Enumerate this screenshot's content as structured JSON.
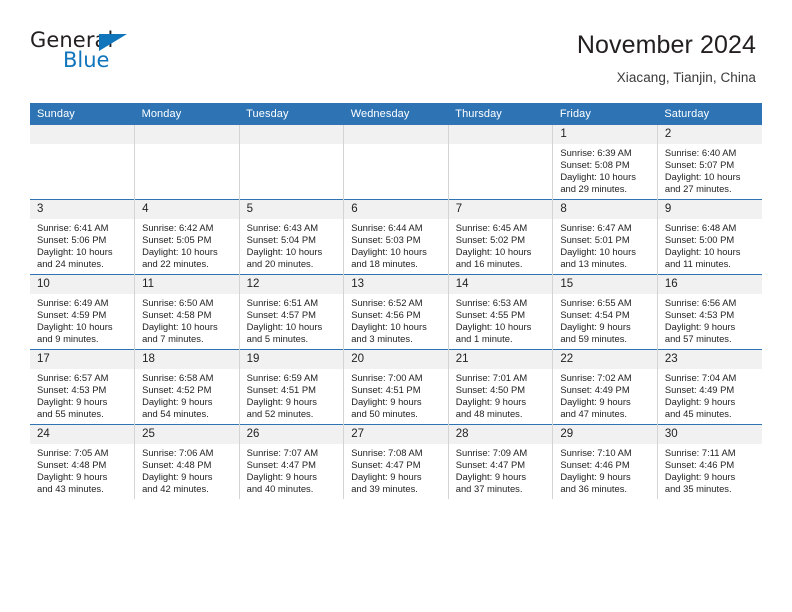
{
  "logo": {
    "word1": "General",
    "word2": "Blue",
    "triangle_icon": "triangle-icon",
    "colors": {
      "blue": "#1175bc",
      "dark": "#231f20"
    }
  },
  "header": {
    "title": "November 2024",
    "subtitle": "Xiacang, Tianjin, China"
  },
  "theme": {
    "header_blue": "#2e74b5",
    "daynum_band": "#f1f1f1",
    "grid_line": "#d4d4d4",
    "text": "#232323"
  },
  "calendar": {
    "weekday_headers": [
      "Sunday",
      "Monday",
      "Tuesday",
      "Wednesday",
      "Thursday",
      "Friday",
      "Saturday"
    ],
    "labels": {
      "sunrise": "Sunrise:",
      "sunset": "Sunset:",
      "daylight": "Daylight:"
    },
    "weeks": [
      [
        {
          "blank": true
        },
        {
          "blank": true
        },
        {
          "blank": true
        },
        {
          "blank": true
        },
        {
          "blank": true
        },
        {
          "day": "1",
          "sunrise": "Sunrise: 6:39 AM",
          "sunset": "Sunset: 5:08 PM",
          "daylight1": "Daylight: 10 hours",
          "daylight2": "and 29 minutes."
        },
        {
          "day": "2",
          "sunrise": "Sunrise: 6:40 AM",
          "sunset": "Sunset: 5:07 PM",
          "daylight1": "Daylight: 10 hours",
          "daylight2": "and 27 minutes."
        }
      ],
      [
        {
          "day": "3",
          "sunrise": "Sunrise: 6:41 AM",
          "sunset": "Sunset: 5:06 PM",
          "daylight1": "Daylight: 10 hours",
          "daylight2": "and 24 minutes."
        },
        {
          "day": "4",
          "sunrise": "Sunrise: 6:42 AM",
          "sunset": "Sunset: 5:05 PM",
          "daylight1": "Daylight: 10 hours",
          "daylight2": "and 22 minutes."
        },
        {
          "day": "5",
          "sunrise": "Sunrise: 6:43 AM",
          "sunset": "Sunset: 5:04 PM",
          "daylight1": "Daylight: 10 hours",
          "daylight2": "and 20 minutes."
        },
        {
          "day": "6",
          "sunrise": "Sunrise: 6:44 AM",
          "sunset": "Sunset: 5:03 PM",
          "daylight1": "Daylight: 10 hours",
          "daylight2": "and 18 minutes."
        },
        {
          "day": "7",
          "sunrise": "Sunrise: 6:45 AM",
          "sunset": "Sunset: 5:02 PM",
          "daylight1": "Daylight: 10 hours",
          "daylight2": "and 16 minutes."
        },
        {
          "day": "8",
          "sunrise": "Sunrise: 6:47 AM",
          "sunset": "Sunset: 5:01 PM",
          "daylight1": "Daylight: 10 hours",
          "daylight2": "and 13 minutes."
        },
        {
          "day": "9",
          "sunrise": "Sunrise: 6:48 AM",
          "sunset": "Sunset: 5:00 PM",
          "daylight1": "Daylight: 10 hours",
          "daylight2": "and 11 minutes."
        }
      ],
      [
        {
          "day": "10",
          "sunrise": "Sunrise: 6:49 AM",
          "sunset": "Sunset: 4:59 PM",
          "daylight1": "Daylight: 10 hours",
          "daylight2": "and 9 minutes."
        },
        {
          "day": "11",
          "sunrise": "Sunrise: 6:50 AM",
          "sunset": "Sunset: 4:58 PM",
          "daylight1": "Daylight: 10 hours",
          "daylight2": "and 7 minutes."
        },
        {
          "day": "12",
          "sunrise": "Sunrise: 6:51 AM",
          "sunset": "Sunset: 4:57 PM",
          "daylight1": "Daylight: 10 hours",
          "daylight2": "and 5 minutes."
        },
        {
          "day": "13",
          "sunrise": "Sunrise: 6:52 AM",
          "sunset": "Sunset: 4:56 PM",
          "daylight1": "Daylight: 10 hours",
          "daylight2": "and 3 minutes."
        },
        {
          "day": "14",
          "sunrise": "Sunrise: 6:53 AM",
          "sunset": "Sunset: 4:55 PM",
          "daylight1": "Daylight: 10 hours",
          "daylight2": "and 1 minute."
        },
        {
          "day": "15",
          "sunrise": "Sunrise: 6:55 AM",
          "sunset": "Sunset: 4:54 PM",
          "daylight1": "Daylight: 9 hours",
          "daylight2": "and 59 minutes."
        },
        {
          "day": "16",
          "sunrise": "Sunrise: 6:56 AM",
          "sunset": "Sunset: 4:53 PM",
          "daylight1": "Daylight: 9 hours",
          "daylight2": "and 57 minutes."
        }
      ],
      [
        {
          "day": "17",
          "sunrise": "Sunrise: 6:57 AM",
          "sunset": "Sunset: 4:53 PM",
          "daylight1": "Daylight: 9 hours",
          "daylight2": "and 55 minutes."
        },
        {
          "day": "18",
          "sunrise": "Sunrise: 6:58 AM",
          "sunset": "Sunset: 4:52 PM",
          "daylight1": "Daylight: 9 hours",
          "daylight2": "and 54 minutes."
        },
        {
          "day": "19",
          "sunrise": "Sunrise: 6:59 AM",
          "sunset": "Sunset: 4:51 PM",
          "daylight1": "Daylight: 9 hours",
          "daylight2": "and 52 minutes."
        },
        {
          "day": "20",
          "sunrise": "Sunrise: 7:00 AM",
          "sunset": "Sunset: 4:51 PM",
          "daylight1": "Daylight: 9 hours",
          "daylight2": "and 50 minutes."
        },
        {
          "day": "21",
          "sunrise": "Sunrise: 7:01 AM",
          "sunset": "Sunset: 4:50 PM",
          "daylight1": "Daylight: 9 hours",
          "daylight2": "and 48 minutes."
        },
        {
          "day": "22",
          "sunrise": "Sunrise: 7:02 AM",
          "sunset": "Sunset: 4:49 PM",
          "daylight1": "Daylight: 9 hours",
          "daylight2": "and 47 minutes."
        },
        {
          "day": "23",
          "sunrise": "Sunrise: 7:04 AM",
          "sunset": "Sunset: 4:49 PM",
          "daylight1": "Daylight: 9 hours",
          "daylight2": "and 45 minutes."
        }
      ],
      [
        {
          "day": "24",
          "sunrise": "Sunrise: 7:05 AM",
          "sunset": "Sunset: 4:48 PM",
          "daylight1": "Daylight: 9 hours",
          "daylight2": "and 43 minutes."
        },
        {
          "day": "25",
          "sunrise": "Sunrise: 7:06 AM",
          "sunset": "Sunset: 4:48 PM",
          "daylight1": "Daylight: 9 hours",
          "daylight2": "and 42 minutes."
        },
        {
          "day": "26",
          "sunrise": "Sunrise: 7:07 AM",
          "sunset": "Sunset: 4:47 PM",
          "daylight1": "Daylight: 9 hours",
          "daylight2": "and 40 minutes."
        },
        {
          "day": "27",
          "sunrise": "Sunrise: 7:08 AM",
          "sunset": "Sunset: 4:47 PM",
          "daylight1": "Daylight: 9 hours",
          "daylight2": "and 39 minutes."
        },
        {
          "day": "28",
          "sunrise": "Sunrise: 7:09 AM",
          "sunset": "Sunset: 4:47 PM",
          "daylight1": "Daylight: 9 hours",
          "daylight2": "and 37 minutes."
        },
        {
          "day": "29",
          "sunrise": "Sunrise: 7:10 AM",
          "sunset": "Sunset: 4:46 PM",
          "daylight1": "Daylight: 9 hours",
          "daylight2": "and 36 minutes."
        },
        {
          "day": "30",
          "sunrise": "Sunrise: 7:11 AM",
          "sunset": "Sunset: 4:46 PM",
          "daylight1": "Daylight: 9 hours",
          "daylight2": "and 35 minutes."
        }
      ]
    ]
  }
}
